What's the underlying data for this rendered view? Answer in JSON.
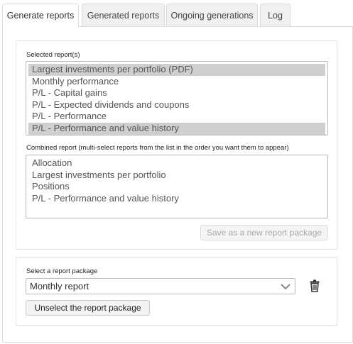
{
  "tabs": [
    {
      "label": "Generate reports",
      "active": true
    },
    {
      "label": "Generated reports",
      "active": false
    },
    {
      "label": "Ongoing generations",
      "active": false
    },
    {
      "label": "Log",
      "active": false
    }
  ],
  "selected_reports": {
    "label": "Selected report(s)",
    "items": [
      {
        "text": "Largest investments per portfolio (PDF)",
        "selected": true
      },
      {
        "text": "Monthly performance",
        "selected": false
      },
      {
        "text": "P/L - Capital gains",
        "selected": false
      },
      {
        "text": "P/L - Expected dividends and coupons",
        "selected": false
      },
      {
        "text": "P/L - Performance",
        "selected": false
      },
      {
        "text": "P/L - Performance and value history",
        "selected": true
      }
    ]
  },
  "combined_report": {
    "label": "Combined report (multi-select reports from the list in the order you want them to appear)",
    "items": [
      {
        "text": "Allocation"
      },
      {
        "text": "Largest investments per portfolio"
      },
      {
        "text": "Positions"
      },
      {
        "text": "P/L - Performance and value history"
      }
    ]
  },
  "save_button_label": "Save as a new report package",
  "package": {
    "label": "Select a report package",
    "selected_value": "Monthly report",
    "chevron_icon": "chevron-down-icon",
    "delete_icon": "trash-icon"
  },
  "unselect_button_label": "Unselect the report package",
  "colors": {
    "selected_row": "#cfcfcf",
    "disabled_text": "#a8a8a8",
    "border": "#dcdcdc"
  }
}
